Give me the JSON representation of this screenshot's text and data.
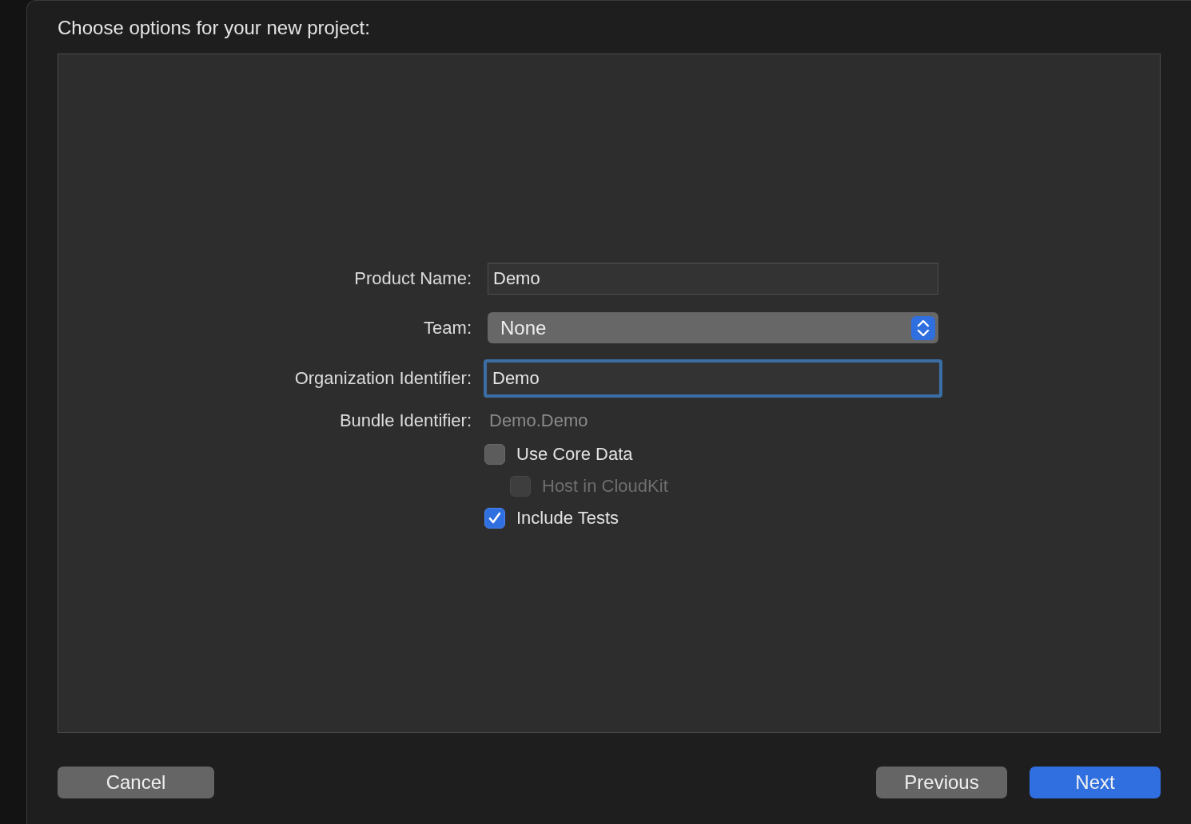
{
  "title": "Choose options for your new project:",
  "fields": [
    {
      "label": "Product Name:",
      "kind": "text",
      "value": "Demo",
      "focused": false
    },
    {
      "label": "Team:",
      "kind": "popup",
      "value": "None"
    },
    {
      "label": "Organization Identifier:",
      "kind": "text",
      "value": "Demo",
      "focused": true
    },
    {
      "label": "Bundle Identifier:",
      "kind": "static",
      "value": "Demo.Demo"
    }
  ],
  "options": [
    {
      "label": "Use Core Data",
      "checked": false,
      "disabled": false,
      "children": [
        {
          "label": "Host in CloudKit",
          "checked": false,
          "disabled": true
        }
      ]
    },
    {
      "label": "Include Tests",
      "checked": true,
      "disabled": false
    }
  ],
  "buttons": [
    {
      "label": "Cancel",
      "kind": "default"
    },
    {
      "label": "Previous",
      "kind": "default"
    },
    {
      "label": "Next",
      "kind": "primary"
    }
  ]
}
